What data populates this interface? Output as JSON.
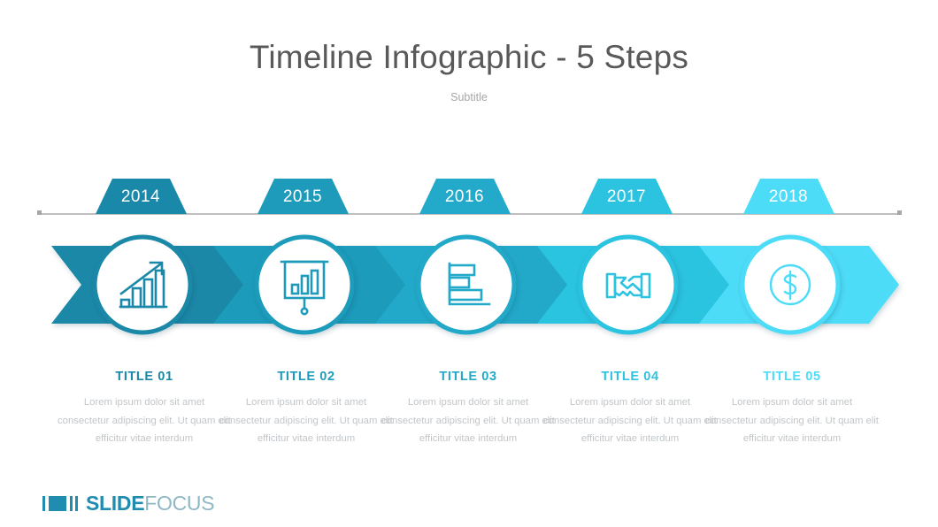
{
  "header": {
    "title": "Timeline Infographic - 5 Steps",
    "subtitle": "Subtitle"
  },
  "colors": {
    "step1": "#1a88a8",
    "step2": "#1e9bbb",
    "step3": "#23a9c9",
    "step4": "#2cc3e0",
    "step5": "#4ddcf8",
    "title_text": "#595959",
    "subtitle_text": "#a6a6a6",
    "body_text": "#c2c6c9",
    "rule": "#bfbfbf",
    "logo_slide": "#1f8cb0",
    "logo_focus": "#8fb8c6"
  },
  "timeline": {
    "rule_label": "timeline-axis",
    "steps": [
      {
        "year": "2014",
        "title": "TITLE 01",
        "body": "Lorem ipsum dolor sit amet consectetur adipiscing elit. Ut quam elit efficitur vitae interdum",
        "icon": "bar-chart-growth-icon",
        "color": "#1a88a8"
      },
      {
        "year": "2015",
        "title": "TITLE 02",
        "body": "Lorem ipsum dolor sit amet consectetur adipiscing elit. Ut quam elit efficitur vitae interdum",
        "icon": "presentation-board-icon",
        "color": "#1e9bbb"
      },
      {
        "year": "2016",
        "title": "TITLE 03",
        "body": "Lorem ipsum dolor sit amet consectetur adipiscing elit. Ut quam elit efficitur vitae interdum",
        "icon": "horizontal-bar-chart-icon",
        "color": "#23a9c9"
      },
      {
        "year": "2017",
        "title": "TITLE 04",
        "body": "Lorem ipsum dolor sit amet consectetur adipiscing elit. Ut quam elit efficitur vitae interdum",
        "icon": "handshake-icon",
        "color": "#2cc3e0"
      },
      {
        "year": "2018",
        "title": "TITLE 05",
        "body": "Lorem ipsum dolor sit amet consectetur adipiscing elit. Ut quam elit efficitur vitae interdum",
        "icon": "dollar-coin-icon",
        "color": "#4ddcf8"
      }
    ]
  },
  "logo": {
    "bold_text": "SLIDE",
    "light_text": "FOCUS"
  }
}
